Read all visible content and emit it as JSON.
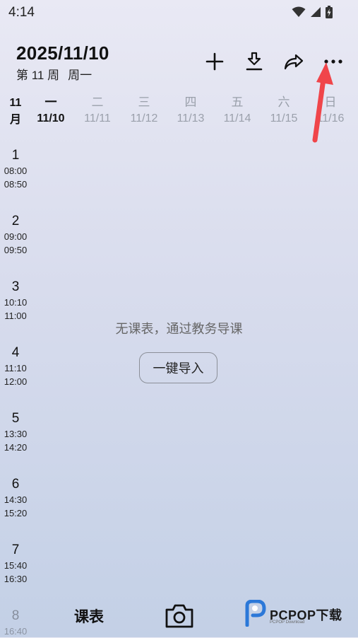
{
  "status": {
    "time": "4:14"
  },
  "header": {
    "date": "2025/11/10",
    "week": "第 11 周",
    "weekday": "周一"
  },
  "toolbar": {
    "icons": [
      "plus-icon",
      "download-icon",
      "share-icon",
      "more-icon"
    ]
  },
  "days": {
    "month_num": "11",
    "month_unit": "月",
    "cols": [
      {
        "name": "一",
        "date": "11/10",
        "active": true
      },
      {
        "name": "二",
        "date": "11/11"
      },
      {
        "name": "三",
        "date": "11/12"
      },
      {
        "name": "四",
        "date": "11/13"
      },
      {
        "name": "五",
        "date": "11/14"
      },
      {
        "name": "六",
        "date": "11/15"
      },
      {
        "name": "日",
        "date": "11/16"
      }
    ]
  },
  "periods": [
    {
      "num": "1",
      "start": "08:00",
      "end": "08:50"
    },
    {
      "num": "2",
      "start": "09:00",
      "end": "09:50"
    },
    {
      "num": "3",
      "start": "10:10",
      "end": "11:00"
    },
    {
      "num": "4",
      "start": "11:10",
      "end": "12:00"
    },
    {
      "num": "5",
      "start": "13:30",
      "end": "14:20"
    },
    {
      "num": "6",
      "start": "14:30",
      "end": "15:20"
    },
    {
      "num": "7",
      "start": "15:40",
      "end": "16:30"
    },
    {
      "num": "8",
      "start": "16:40"
    }
  ],
  "empty": {
    "message": "无课表，通过教务导课",
    "import_label": "一键导入"
  },
  "nav": {
    "schedule": "课表"
  },
  "watermark": {
    "brand": "PCPOP下载",
    "sub": "PCPOP Download"
  },
  "colors": {
    "accent_arrow": "#f0454a",
    "inactive_day": "#9aa0ab"
  }
}
